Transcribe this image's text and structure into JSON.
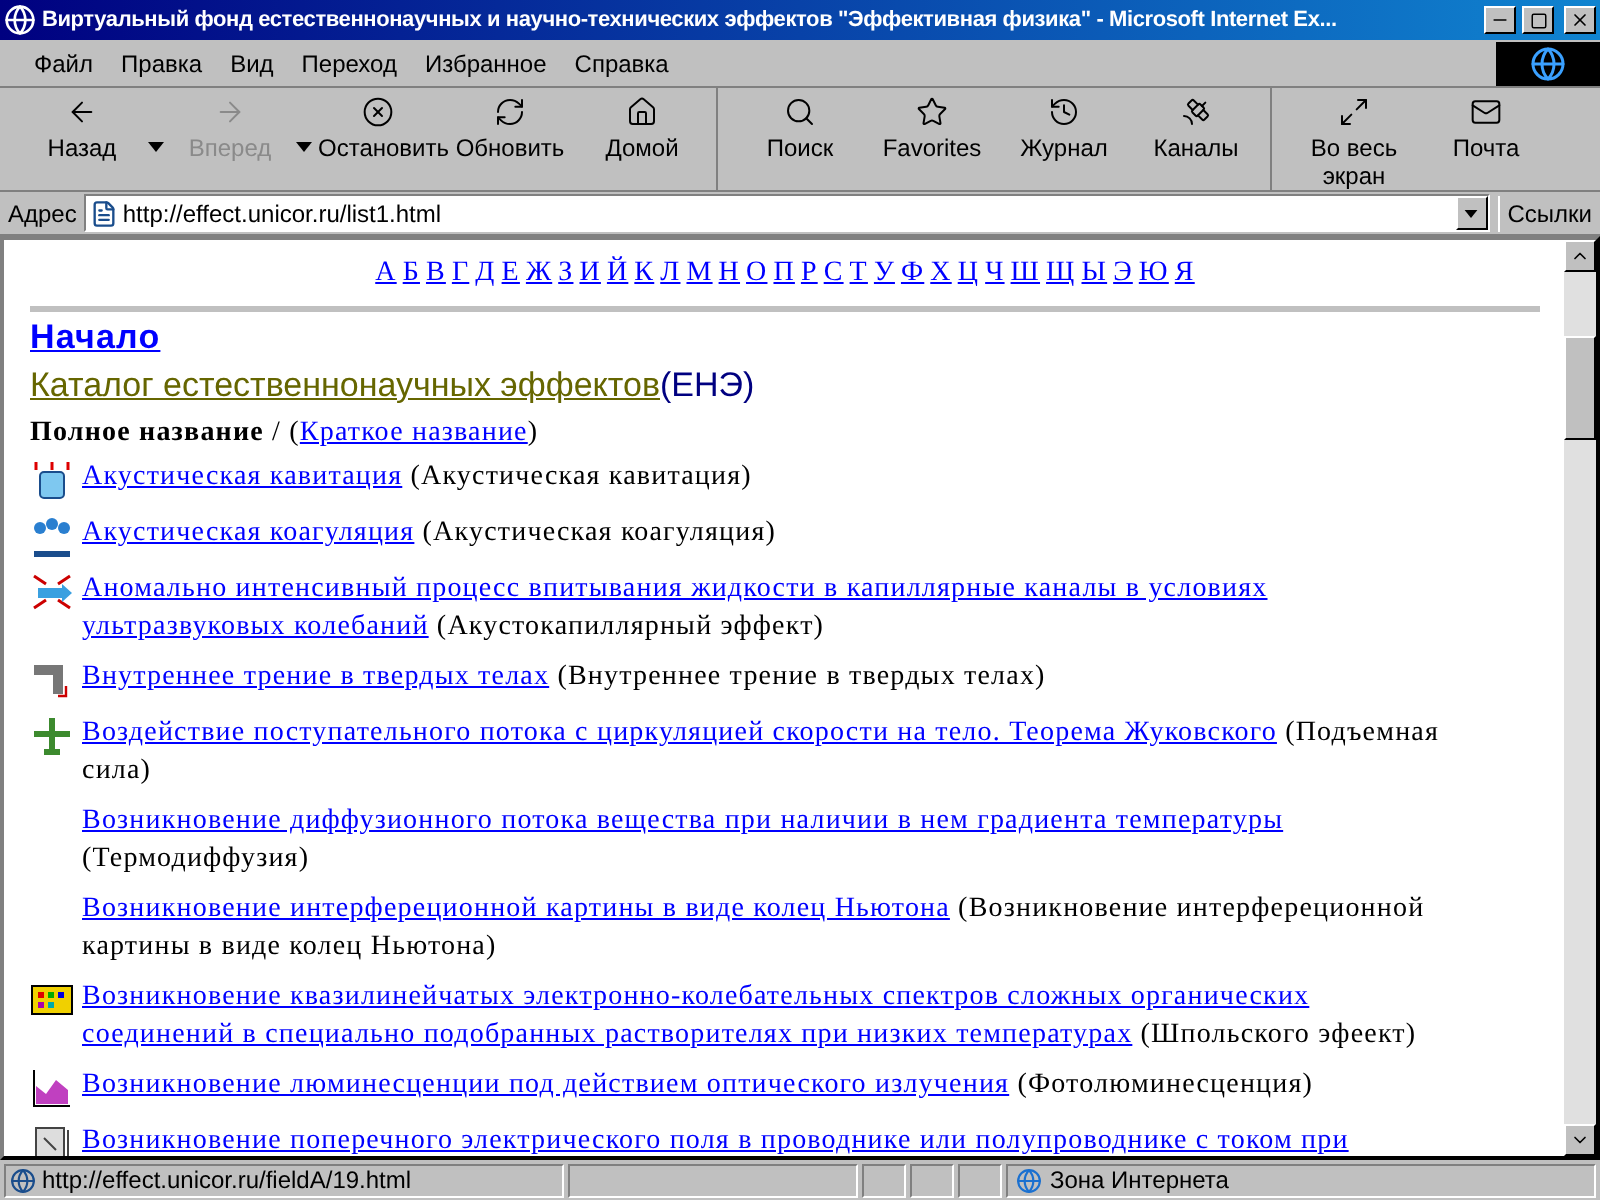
{
  "window": {
    "title": "Виртуальный фонд естественнонаучных и научно-технических эффектов \"Эффективная физика\" - Microsoft Internet Ex..."
  },
  "menu": [
    "Файл",
    "Правка",
    "Вид",
    "Переход",
    "Избранное",
    "Справка"
  ],
  "toolbar": {
    "groups": [
      [
        {
          "kind": "back",
          "label": "Назад",
          "disabled": false,
          "dropdown": true
        },
        {
          "kind": "forward",
          "label": "Вперед",
          "disabled": true,
          "dropdown": true
        },
        {
          "kind": "stop",
          "label": "Остановить",
          "disabled": false,
          "dropdown": false
        },
        {
          "kind": "refresh",
          "label": "Обновить",
          "disabled": false,
          "dropdown": false
        },
        {
          "kind": "home",
          "label": "Домой",
          "disabled": false,
          "dropdown": false
        }
      ],
      [
        {
          "kind": "search",
          "label": "Поиск",
          "disabled": false,
          "dropdown": false
        },
        {
          "kind": "favorites",
          "label": "Favorites",
          "disabled": false,
          "dropdown": false
        },
        {
          "kind": "history",
          "label": "Журнал",
          "disabled": false,
          "dropdown": false
        },
        {
          "kind": "channels",
          "label": "Каналы",
          "disabled": false,
          "dropdown": false
        }
      ],
      [
        {
          "kind": "fullscreen",
          "label": "Во весь экран",
          "disabled": false,
          "dropdown": false
        },
        {
          "kind": "mail",
          "label": "Почта",
          "disabled": false,
          "dropdown": false
        }
      ]
    ]
  },
  "address": {
    "label": "Адрес",
    "value": "http://effect.unicor.ru/list1.html",
    "links": "Ссылки"
  },
  "page": {
    "letters": [
      "А",
      "Б",
      "В",
      "Г",
      "Д",
      "Е",
      "Ж",
      "З",
      "И",
      "Й",
      "К",
      "Л",
      "М",
      "Н",
      "О",
      "П",
      "Р",
      "С",
      "Т",
      "У",
      "Ф",
      "Х",
      "Ц",
      "Ч",
      "Ш",
      "Щ",
      "Ы",
      "Э",
      "Ю",
      "Я"
    ],
    "home_link": "Начало",
    "catalog_link": "Каталог естественнонаучных эффектов",
    "catalog_abbr": "(ЕНЭ)",
    "legend_bold": "Полное название",
    "legend_sep": " / (",
    "legend_link": "Краткое название",
    "legend_end": ")",
    "items": [
      {
        "link": "Акустическая кавитация",
        "short": "(Акустическая кавитация)"
      },
      {
        "link": "Акустическая коагуляция",
        "short": "(Акустическая коагуляция)"
      },
      {
        "link": "Аномально интенсивный процесс впитывания жидкости в капиллярные каналы в условиях ультразвуковых колебаний",
        "short": "(Акустокапиллярный эффект)"
      },
      {
        "link": "Внутреннее трение в твердых телах",
        "short": "(Внутреннее трение в твердых телах)"
      },
      {
        "link": "Воздействие поступательного потока с циркуляцией скорости на тело. Теорема Жуковского",
        "short": "(Подъемная сила)"
      },
      {
        "link": "Возникновение диффузионного потока вещества при наличии в нем градиента температуры",
        "short": "(Термодиффузия)"
      },
      {
        "link": "Возникновение интерфереционной картины в виде колец Ньютона",
        "short": "(Возникновение интерфереционной картины в виде колец Ньютона)"
      },
      {
        "link": "Возникновение квазилинейчатых электронно-колебательных спектров сложных органических соединений в специально подобранных растворителях при низких температурах",
        "short": "(Шпольского эфеект)"
      },
      {
        "link": "Возникновение люминесценции под действием оптического излучения",
        "short": "(Фотолюминесценция)"
      },
      {
        "link": "Возникновение поперечного электрического поля в проводнике или полупроводнике с током при"
      }
    ]
  },
  "status_bar": {
    "url": "http://effect.unicor.ru/fieldA/19.html",
    "zone": "Зона Интернета"
  }
}
